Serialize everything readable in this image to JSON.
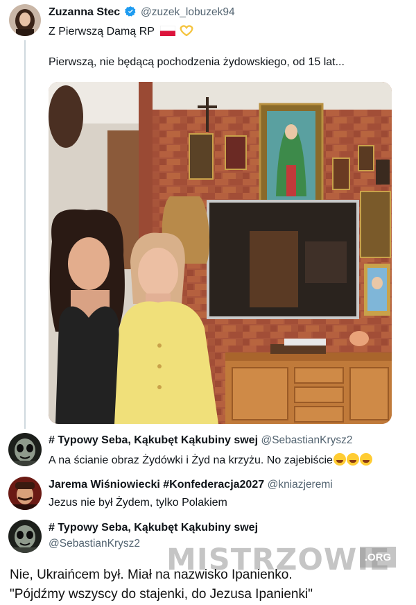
{
  "colors": {
    "verified": "#1d9bf0",
    "thread_line": "#cfd9de",
    "handle": "#536471"
  },
  "main_tweet": {
    "name": "Zuzanna Stec",
    "handle": "@zuzek_lobuzek94",
    "line1": "Z Pierwszą Damą RP",
    "line2": "Pierwszą,  nie będącą pochodzenia żydowskiego, od 15 lat...",
    "icons": [
      "verified-badge-icon",
      "poland-flag-icon",
      "heart-hands-icon"
    ]
  },
  "replies": [
    {
      "name": "# Typowy Seba, Kąkubęt Kąkubiny swej",
      "handle": "@SebastianKrysz2",
      "text": "A na ścianie obraz Żydówki i Żyd na krzyżu. No zajebiście",
      "icons": [
        "laughing-emoji-icon",
        "laughing-emoji-icon",
        "laughing-emoji-icon"
      ]
    },
    {
      "name": "Jarema Wiśniowiecki #Konfederacja2027",
      "handle": "@kniazjeremi",
      "text": "Jezus nie był Żydem, tylko Polakiem"
    },
    {
      "name": "# Typowy Seba, Kąkubęt Kąkubiny swej",
      "handle": "@SebastianKrysz2"
    }
  ],
  "bottom_text": {
    "line1": "Nie, Ukraińcem był. Miał na nazwisko Ipanienko.",
    "line2": "\"Pójdźmy wszyscy do stajenki, do Jezusa Ipanienki\""
  },
  "watermark": {
    "text": "MISTRZOWIE",
    "suffix": ".ORG"
  }
}
